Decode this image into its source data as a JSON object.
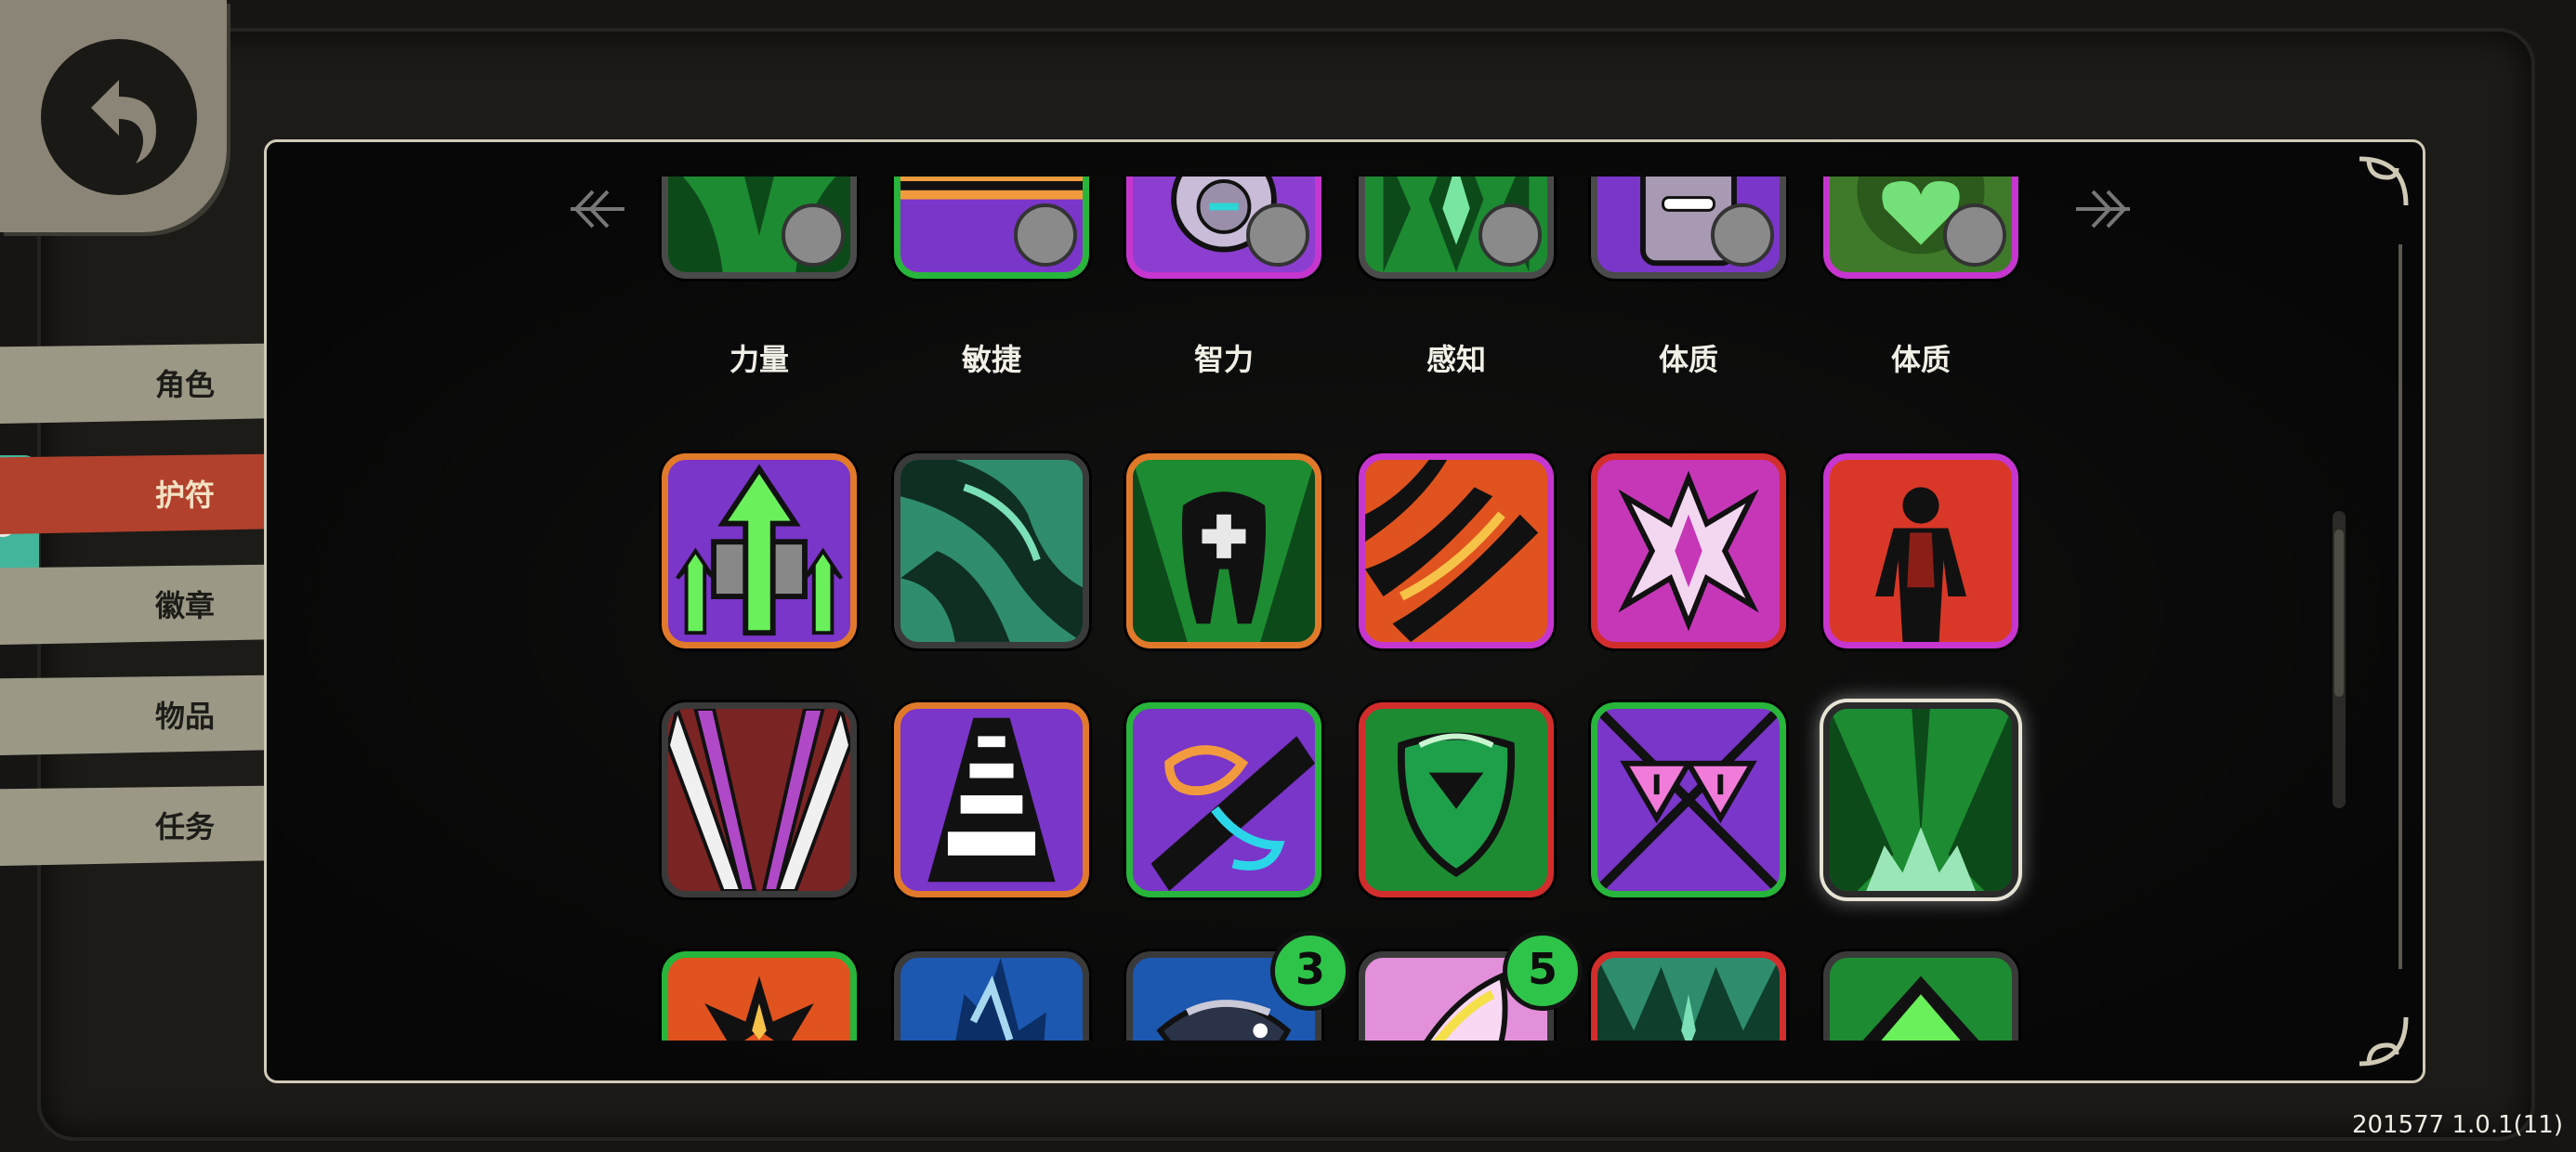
{
  "back_button": {
    "icon": "back-arrow-icon"
  },
  "sidebar": {
    "items": [
      {
        "label": "角色",
        "active": false
      },
      {
        "label": "护符",
        "active": true
      },
      {
        "label": "徽章",
        "active": false
      },
      {
        "label": "物品",
        "active": false
      },
      {
        "label": "任务",
        "active": false
      }
    ]
  },
  "stats_row": {
    "items": [
      {
        "label": "力量",
        "border": "#4a4a4a",
        "badge_icon": "strength-icon"
      },
      {
        "label": "敏捷",
        "border": "#27b53b",
        "badge_icon": "agility-icon"
      },
      {
        "label": "智力",
        "border": "#c636cf",
        "badge_icon": "intellect-icon"
      },
      {
        "label": "感知",
        "border": "#4a4a4a",
        "badge_icon": "perception-icon"
      },
      {
        "label": "体质",
        "border": "#4a4a4a",
        "badge_icon": "constitution-icon"
      },
      {
        "label": "体质",
        "border": "#c636cf",
        "badge_icon": "constitution-icon"
      }
    ]
  },
  "charms": [
    {
      "icon": "arrow-up-icon",
      "border": "#e07a2a",
      "bg": "#7a35c9"
    },
    {
      "icon": "wave-icon",
      "border": "#3a3a3a",
      "bg": "#2f8d6d"
    },
    {
      "icon": "tooth-icon",
      "border": "#e07a2a",
      "bg": "#1d8b32"
    },
    {
      "icon": "claw-icon",
      "border": "#c636cf",
      "bg": "#e0531f"
    },
    {
      "icon": "crystal-icon",
      "border": "#d22d2d",
      "bg": "#c637b8"
    },
    {
      "icon": "figure-icon",
      "border": "#c636cf",
      "bg": "#d93828"
    },
    {
      "icon": "spikes-icon",
      "border": "#3a3a3a",
      "bg": "#7b2424"
    },
    {
      "icon": "stairs-icon",
      "border": "#e07a2a",
      "bg": "#7a35c9"
    },
    {
      "icon": "chain-icon",
      "border": "#27b53b",
      "bg": "#7a35c9"
    },
    {
      "icon": "shield-icon",
      "border": "#d22d2d",
      "bg": "#1d8b32"
    },
    {
      "icon": "warning-icon",
      "border": "#27b53b",
      "bg": "#7a35c9"
    },
    {
      "icon": "grass-icon",
      "border": "#2a2a2a",
      "bg": "#1d8b32",
      "selected": true
    },
    {
      "icon": "flame-icon",
      "border": "#27b53b",
      "bg": "#e0531f"
    },
    {
      "icon": "branch-icon",
      "border": "#3a3a3a",
      "bg": "#1c57b0"
    },
    {
      "icon": "fish-icon",
      "border": "#3a3a3a",
      "bg": "#1c57b0",
      "count": "3"
    },
    {
      "icon": "blade-icon",
      "border": "#3a3a3a",
      "bg": "#e290d9",
      "count": "5"
    },
    {
      "icon": "fern-icon",
      "border": "#d22d2d",
      "bg": "#2f8d6d"
    },
    {
      "icon": "peak-icon",
      "border": "#3a3a3a",
      "bg": "#1d8b32"
    }
  ],
  "version": "201577 1.0.1(11)"
}
